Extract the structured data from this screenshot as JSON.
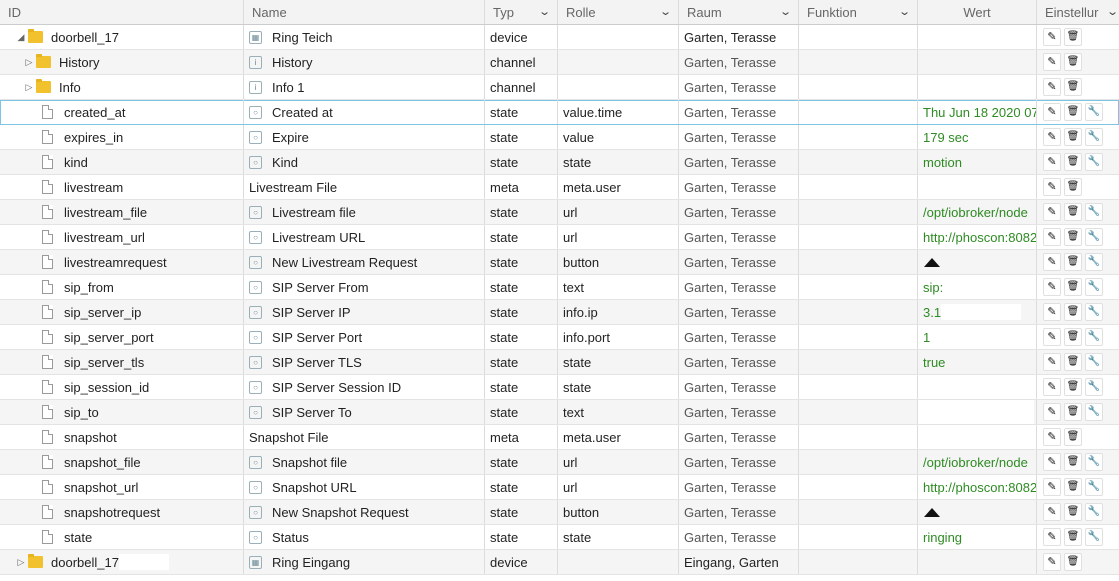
{
  "header": {
    "id": "ID",
    "name": "Name",
    "type": "Typ",
    "role": "Rolle",
    "room": "Raum",
    "function": "Funktion",
    "value": "Wert",
    "settings": "Einstellur"
  },
  "rows": [
    {
      "kind": "folder",
      "level": 0,
      "toggle": "▲",
      "id": "doorbell_17",
      "name": "Ring Teich",
      "nameIcon": "device",
      "type": "device",
      "role": "",
      "room": "Garten, Terasse",
      "value": "",
      "actions": 2,
      "idRedact": true
    },
    {
      "kind": "folder",
      "level": 1,
      "toggle": "▷",
      "id": "History",
      "name": "History",
      "nameIcon": "channel",
      "type": "channel",
      "role": "",
      "room": "Garten, Terasse",
      "value": "",
      "actions": 2
    },
    {
      "kind": "folder",
      "level": 1,
      "toggle": "▷",
      "id": "Info",
      "name": "Info 1",
      "nameIcon": "channel",
      "type": "channel",
      "role": "",
      "room": "Garten, Terasse",
      "value": "",
      "actions": 2,
      "nameRedact": true
    },
    {
      "kind": "file",
      "level": 2,
      "id": "created_at",
      "name": "Created at",
      "nameIcon": "state",
      "type": "state",
      "role": "value.time",
      "room": "Garten, Terasse",
      "value": "Thu Jun 18 2020 07:",
      "actions": 3,
      "selected": true
    },
    {
      "kind": "file",
      "level": 2,
      "id": "expires_in",
      "name": "Expire",
      "nameIcon": "state",
      "type": "state",
      "role": "value",
      "room": "Garten, Terasse",
      "value": "179 sec",
      "actions": 3
    },
    {
      "kind": "file",
      "level": 2,
      "id": "kind",
      "name": "Kind",
      "nameIcon": "state",
      "type": "state",
      "role": "state",
      "room": "Garten, Terasse",
      "value": "motion",
      "actions": 3
    },
    {
      "kind": "file",
      "level": 2,
      "id": "livestream",
      "name": "Livestream File",
      "nameIcon": "",
      "type": "meta",
      "role": "meta.user",
      "room": "Garten, Terasse",
      "value": "",
      "actions": 2
    },
    {
      "kind": "file",
      "level": 2,
      "id": "livestream_file",
      "name": "Livestream file",
      "nameIcon": "state",
      "type": "state",
      "role": "url",
      "room": "Garten, Terasse",
      "value": "/opt/iobroker/node",
      "actions": 3
    },
    {
      "kind": "file",
      "level": 2,
      "id": "livestream_url",
      "name": "Livestream URL",
      "nameIcon": "state",
      "type": "state",
      "role": "url",
      "room": "Garten, Terasse",
      "value": "http://phoscon:8082",
      "actions": 3
    },
    {
      "kind": "file",
      "level": 2,
      "id": "livestreamrequest",
      "name": "New Livestream Request",
      "nameIcon": "state",
      "type": "state",
      "role": "button",
      "room": "Garten, Terasse",
      "value": "",
      "button": true,
      "actions": 3
    },
    {
      "kind": "file",
      "level": 2,
      "id": "sip_from",
      "name": "SIP Server From",
      "nameIcon": "state",
      "type": "state",
      "role": "text",
      "room": "Garten, Terasse",
      "value": "sip:",
      "actions": 3,
      "valRedact": true
    },
    {
      "kind": "file",
      "level": 2,
      "id": "sip_server_ip",
      "name": "SIP Server IP",
      "nameIcon": "state",
      "type": "state",
      "role": "info.ip",
      "room": "Garten, Terasse",
      "value": "3.1",
      "actions": 3,
      "valRedact": true
    },
    {
      "kind": "file",
      "level": 2,
      "id": "sip_server_port",
      "name": "SIP Server Port",
      "nameIcon": "state",
      "type": "state",
      "role": "info.port",
      "room": "Garten, Terasse",
      "value": "1",
      "actions": 3,
      "valRedact": true
    },
    {
      "kind": "file",
      "level": 2,
      "id": "sip_server_tls",
      "name": "SIP Server TLS",
      "nameIcon": "state",
      "type": "state",
      "role": "state",
      "room": "Garten, Terasse",
      "value": "true",
      "actions": 3
    },
    {
      "kind": "file",
      "level": 2,
      "id": "sip_session_id",
      "name": "SIP Server Session ID",
      "nameIcon": "state",
      "type": "state",
      "role": "state",
      "room": "Garten, Terasse",
      "value": "",
      "actions": 3,
      "blank": true
    },
    {
      "kind": "file",
      "level": 2,
      "id": "sip_to",
      "name": "SIP Server To",
      "nameIcon": "state",
      "type": "state",
      "role": "text",
      "room": "Garten, Terasse",
      "value": "",
      "actions": 3,
      "blank": true
    },
    {
      "kind": "file",
      "level": 2,
      "id": "snapshot",
      "name": "Snapshot File",
      "nameIcon": "",
      "type": "meta",
      "role": "meta.user",
      "room": "Garten, Terasse",
      "value": "",
      "actions": 2
    },
    {
      "kind": "file",
      "level": 2,
      "id": "snapshot_file",
      "name": "Snapshot file",
      "nameIcon": "state",
      "type": "state",
      "role": "url",
      "room": "Garten, Terasse",
      "value": "/opt/iobroker/node",
      "actions": 3
    },
    {
      "kind": "file",
      "level": 2,
      "id": "snapshot_url",
      "name": "Snapshot URL",
      "nameIcon": "state",
      "type": "state",
      "role": "url",
      "room": "Garten, Terasse",
      "value": "http://phoscon:8082",
      "actions": 3
    },
    {
      "kind": "file",
      "level": 2,
      "id": "snapshotrequest",
      "name": "New Snapshot Request",
      "nameIcon": "state",
      "type": "state",
      "role": "button",
      "room": "Garten, Terasse",
      "value": "",
      "button": true,
      "actions": 3
    },
    {
      "kind": "file",
      "level": 2,
      "id": "state",
      "name": "Status",
      "nameIcon": "state",
      "type": "state",
      "role": "state",
      "room": "Garten, Terasse",
      "value": "ringing",
      "actions": 3
    },
    {
      "kind": "folder",
      "level": 0,
      "toggle": "▷",
      "id": "doorbell_17",
      "name": "Ring Eingang",
      "nameIcon": "device",
      "type": "device",
      "role": "",
      "room": "Eingang, Garten",
      "value": "",
      "actions": 2,
      "idRedact": true
    }
  ],
  "icons": {
    "edit": "pencil-icon",
    "delete": "trash-icon",
    "settings": "wrench-icon"
  }
}
